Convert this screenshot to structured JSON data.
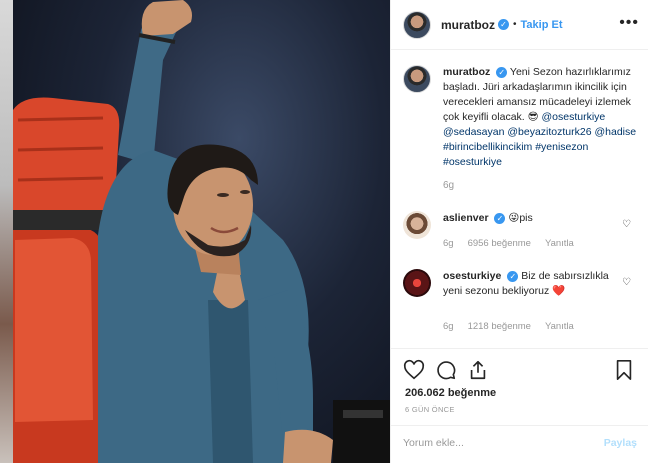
{
  "header": {
    "username": "muratboz",
    "separator": "•",
    "follow_label": "Takip Et",
    "more_icon": "more-dots-icon"
  },
  "caption": {
    "username": "muratboz",
    "text": "Yeni Sezon hazırlıklarımız başladı. Jüri arkadaşlarımın ikincilik için verecekleri amansız mücadeleyi izlemek çok keyifli olacak. 😎",
    "tags": [
      "@osesturkiye",
      "@sedasayan",
      "@beyazitozturk26",
      "@hadise",
      "#birincibellikincikim",
      "#yenisezon",
      "#osesturkiye"
    ],
    "time": "6g"
  },
  "comments": [
    {
      "username": "aslienver",
      "text": "😜pis",
      "time": "6g",
      "likes": "6956 beğenme",
      "reply": "Yanıtla"
    },
    {
      "username": "osesturkiye",
      "text": "Biz de sabırsızlıkla yeni sezonu bekliyoruz ❤️",
      "time": "6g",
      "likes": "1218 beğenme",
      "reply": "Yanıtla"
    }
  ],
  "actions": {
    "like_icon": "heart-icon",
    "comment_icon": "comment-icon",
    "share_icon": "share-icon",
    "save_icon": "bookmark-icon",
    "likes_count": "206.062 beğenme",
    "time_ago": "6 GÜN ÖNCE"
  },
  "add_comment": {
    "placeholder": "Yorum ekle...",
    "post_label": "Paylaş"
  },
  "colors": {
    "accent": "#3897f0",
    "tag": "#003569",
    "muted": "#999999",
    "post_disabled": "#b2dffc",
    "chair_red": "#d9472b"
  }
}
